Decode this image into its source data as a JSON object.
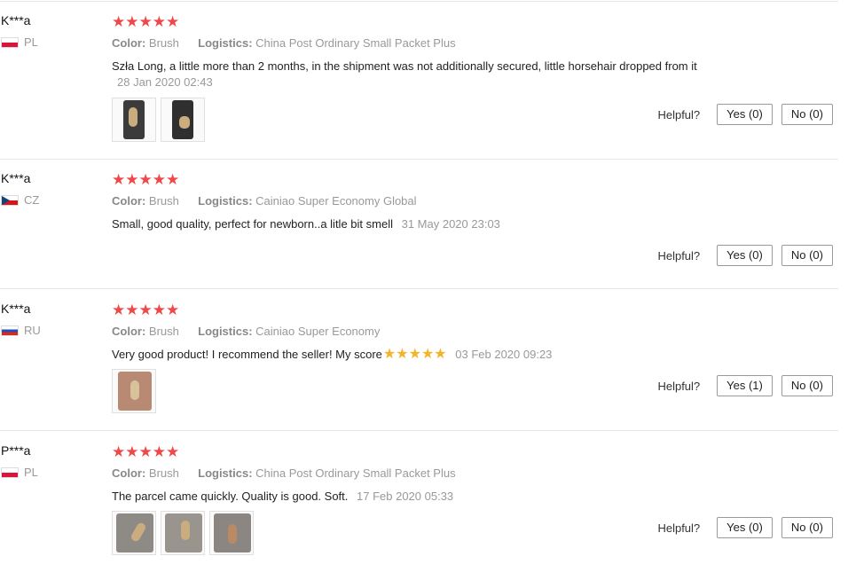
{
  "reviews": [
    {
      "user": "K***a",
      "country": "PL",
      "stars": "★★★★★",
      "color_label": "Color:",
      "color_value": "Brush",
      "logistics_label": "Logistics:",
      "logistics_value": "China Post Ordinary Small Packet Plus",
      "text": "Szła Long, a little more than 2 months, in the shipment was not additionally secured, little horsehair dropped from it",
      "date": "28 Jan 2020 02:43",
      "helpful_label": "Helpful?",
      "yes_label": "Yes (0)",
      "no_label": "No (0)"
    },
    {
      "user": "K***a",
      "country": "CZ",
      "stars": "★★★★★",
      "color_label": "Color:",
      "color_value": "Brush",
      "logistics_label": "Logistics:",
      "logistics_value": "Cainiao Super Economy Global",
      "text": "Small, good quality, perfect for newborn..a litle bit smell",
      "date": "31 May 2020 23:03",
      "helpful_label": "Helpful?",
      "yes_label": "Yes (0)",
      "no_label": "No (0)"
    },
    {
      "user": "K***a",
      "country": "RU",
      "stars": "★★★★★",
      "color_label": "Color:",
      "color_value": "Brush",
      "logistics_label": "Logistics:",
      "logistics_value": "Cainiao Super Economy",
      "text": "Very good product! I recommend the seller! My score",
      "inline_stars": "★★★★★",
      "date": "03 Feb 2020 09:23",
      "helpful_label": "Helpful?",
      "yes_label": "Yes (1)",
      "no_label": "No (0)"
    },
    {
      "user": "P***a",
      "country": "PL",
      "stars": "★★★★★",
      "color_label": "Color:",
      "color_value": "Brush",
      "logistics_label": "Logistics:",
      "logistics_value": "China Post Ordinary Small Packet Plus",
      "text": "The parcel came quickly. Quality is good. Soft.",
      "date": "17 Feb 2020 05:33",
      "helpful_label": "Helpful?",
      "yes_label": "Yes (0)",
      "no_label": "No (0)"
    }
  ],
  "colors": {
    "star_red": "#f04848",
    "star_yellow": "#f3b32a"
  }
}
